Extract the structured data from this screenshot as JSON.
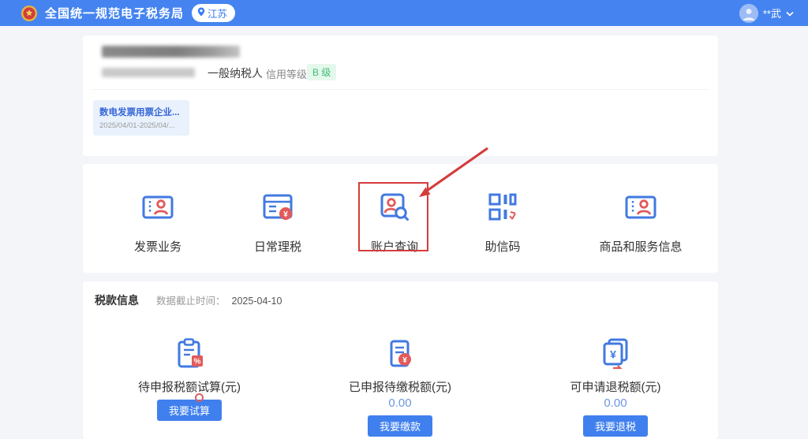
{
  "header": {
    "title": "全国统一规范电子税务局",
    "region": "江苏",
    "user": "**武",
    "icons": {
      "logo": "national-emblem-icon",
      "pin": "location-pin-icon",
      "avatar": "user-avatar-icon",
      "chevron": "chevron-down-icon"
    }
  },
  "company": {
    "taxpayer_type": "一般纳税人",
    "credit_label": "信用等级：",
    "credit_grade": "B 级",
    "notice_title": "数电发票用票企业...",
    "notice_dates": "2025/04/01-2025/04/..."
  },
  "nav": {
    "items": [
      {
        "label": "发票业务",
        "icon": "ticket-person-icon"
      },
      {
        "label": "日常理税",
        "icon": "table-yuan-badge-icon"
      },
      {
        "label": "账户查询",
        "icon": "person-search-icon",
        "highlighted": true
      },
      {
        "label": "助信码",
        "icon": "qr-code-icon"
      },
      {
        "label": "商品和服务信息",
        "icon": "ticket-person-icon"
      }
    ]
  },
  "tax_info": {
    "title": "税款信息",
    "cutoff_label": "数据截止时间：",
    "cutoff_date": "2025-04-10",
    "stats": [
      {
        "label": "待申报税额试算(元)",
        "button": "我要试算",
        "icon": "clipboard-percent-icon"
      },
      {
        "label": "已申报待缴税额(元)",
        "value": "0.00",
        "button": "我要缴款",
        "icon": "document-yuan-icon"
      },
      {
        "label": "可申请退税额(元)",
        "value": "0.00",
        "button": "我要退税",
        "icon": "stacked-notes-yuan-icon"
      }
    ]
  },
  "annotation": {
    "type": "red-box-and-arrow",
    "target": "账户查询",
    "color": "#d43c3c"
  },
  "colors": {
    "header_bg": "#4584f0",
    "accent_blue": "#3f7ce8",
    "icon_blue": "#4179e1",
    "icon_red": "#e25a5a",
    "annotation_red": "#d43c3c",
    "credit_green": "#42bd75",
    "page_bg": "#f3f5f9"
  }
}
